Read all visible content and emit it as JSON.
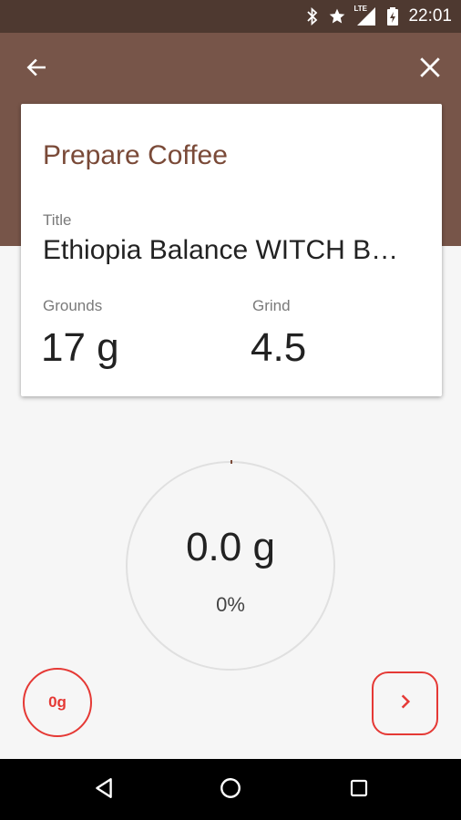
{
  "status_bar": {
    "time": "22:01",
    "icons": [
      "bluetooth-icon",
      "star-icon",
      "lte-signal-icon",
      "battery-charging-icon"
    ],
    "network_label": "LTE",
    "background_color": "#4e3930"
  },
  "app_bar": {
    "background_color": "#775549",
    "back_icon": "arrow-left-icon",
    "close_icon": "close-icon"
  },
  "card": {
    "title": "Prepare Coffee",
    "title_label": "Title",
    "title_value": "Ethiopia Balance WITCH B…",
    "grounds_label": "Grounds",
    "grounds_value": "17 g",
    "grind_label": "Grind",
    "grind_value": "4.5"
  },
  "scale": {
    "weight": "0.0 g",
    "percent": "0%",
    "progress": 0
  },
  "buttons": {
    "tare_label": "0g",
    "next_icon": "chevron-right-icon",
    "accent_color": "#e53935"
  },
  "nav_bar": {
    "icons": [
      "back-triangle-icon",
      "home-circle-icon",
      "recents-square-icon"
    ]
  }
}
